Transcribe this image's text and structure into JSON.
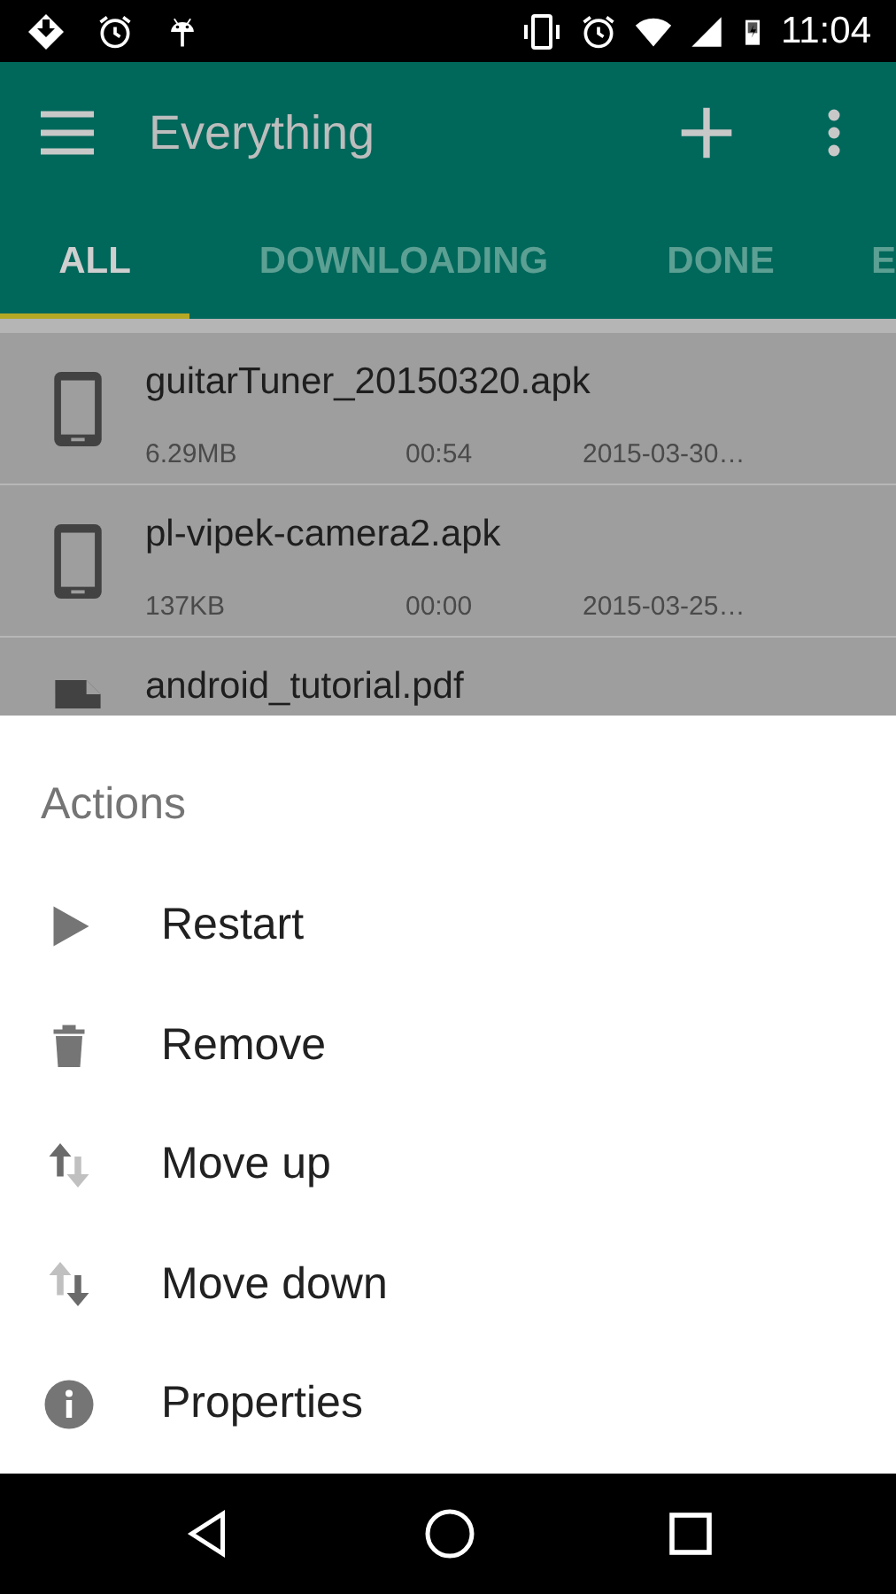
{
  "status_bar": {
    "time": "11:04"
  },
  "toolbar": {
    "title": "Everything"
  },
  "tabs": [
    {
      "label": "ALL",
      "selected": true
    },
    {
      "label": "DOWNLOADING",
      "selected": false
    },
    {
      "label": "DONE",
      "selected": false
    },
    {
      "label": "E",
      "selected": false
    }
  ],
  "files": [
    {
      "kind": "app",
      "name": "guitarTuner_20150320.apk",
      "size": "6.29MB",
      "time": "00:54",
      "date": "2015-03-30…"
    },
    {
      "kind": "app",
      "name": "pl-vipek-camera2.apk",
      "size": "137KB",
      "time": "00:00",
      "date": "2015-03-25…"
    },
    {
      "kind": "document",
      "name": "android_tutorial.pdf"
    }
  ],
  "sheet": {
    "title": "Actions",
    "items": [
      {
        "kind": "play",
        "label": "Restart"
      },
      {
        "kind": "trash",
        "label": "Remove"
      },
      {
        "kind": "up",
        "label": "Move up"
      },
      {
        "kind": "down",
        "label": "Move down"
      },
      {
        "kind": "info",
        "label": "Properties"
      }
    ]
  }
}
